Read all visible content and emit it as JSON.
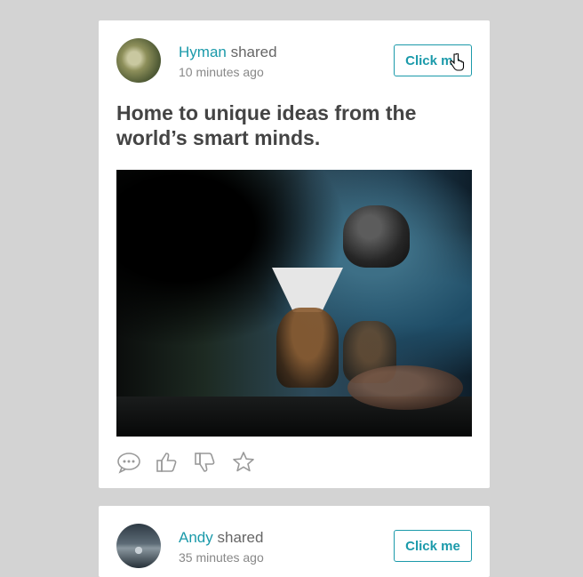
{
  "posts": [
    {
      "author": "Hyman",
      "action_text": "shared",
      "time": "10 minutes ago",
      "button_label": "Click me",
      "title": "Home to unique ideas from the world’s smart minds.",
      "image_desc": "coffee-brewing-photo",
      "actions": [
        "comment-icon",
        "thumbs-up-icon",
        "thumbs-down-icon",
        "star-icon"
      ]
    },
    {
      "author": "Andy",
      "action_text": "shared",
      "time": "35 minutes ago",
      "button_label": "Click me"
    }
  ],
  "colors": {
    "accent": "#1b9aaa",
    "background": "#d3d3d3",
    "card": "#ffffff",
    "title_text": "#444444",
    "meta_text": "#888888"
  }
}
